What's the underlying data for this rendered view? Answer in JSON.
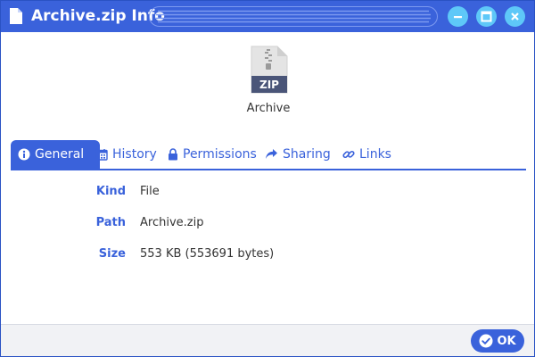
{
  "window": {
    "title": "Archive.zip Info",
    "accent_color": "#3a62db",
    "button_color": "#5ec8f8",
    "controls": {
      "minimize_icon": "minimize-icon",
      "maximize_icon": "maximize-icon",
      "close_icon": "close-icon"
    }
  },
  "file": {
    "name": "Archive",
    "icon": "zip-file-icon",
    "badge": "ZIP"
  },
  "tabs": [
    {
      "label": "General",
      "icon": "info-icon",
      "active": true
    },
    {
      "label": "History",
      "icon": "calendar-icon",
      "active": false
    },
    {
      "label": "Permissions",
      "icon": "lock-icon",
      "active": false
    },
    {
      "label": "Sharing",
      "icon": "share-icon",
      "active": false
    },
    {
      "label": "Links",
      "icon": "link-icon",
      "active": false
    }
  ],
  "properties": {
    "kind": {
      "label": "Kind",
      "value": "File"
    },
    "path": {
      "label": "Path",
      "value": "Archive.zip"
    },
    "size": {
      "label": "Size",
      "value": "553 KB (553691 bytes)"
    }
  },
  "footer": {
    "ok_label": "OK",
    "ok_icon": "checkmark-icon"
  }
}
